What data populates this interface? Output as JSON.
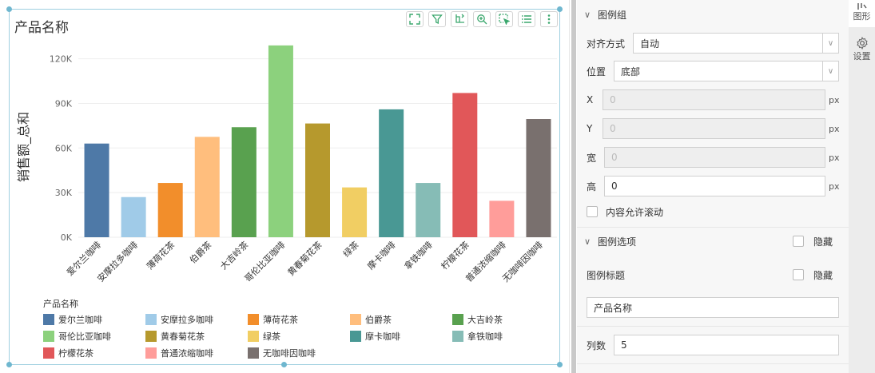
{
  "chart_title": "产品名称",
  "toolbar": {
    "icons": [
      "fullscreen-icon",
      "filter-icon",
      "sort-icon",
      "zoom-icon",
      "select-icon",
      "list-icon",
      "more-icon"
    ]
  },
  "chart_data": {
    "type": "bar",
    "title": "产品名称",
    "ylabel": "销售额_总和",
    "xlabel": "",
    "ylim": [
      0,
      130000
    ],
    "y_ticks": [
      "0K",
      "30K",
      "60K",
      "90K",
      "120K"
    ],
    "y_tick_values": [
      0,
      30000,
      60000,
      90000,
      120000
    ],
    "grid": true,
    "legend_position": "bottom",
    "categories": [
      "爱尔兰咖啡",
      "安摩拉多咖啡",
      "薄荷花茶",
      "伯爵茶",
      "大吉岭茶",
      "哥伦比亚咖啡",
      "黄春菊花茶",
      "绿茶",
      "摩卡咖啡",
      "拿铁咖啡",
      "柠檬花茶",
      "普通浓缩咖啡",
      "无咖啡因咖啡"
    ],
    "values": [
      63000,
      27000,
      36500,
      67500,
      74000,
      129000,
      76500,
      33500,
      86000,
      36500,
      97000,
      24500,
      79500
    ],
    "colors": [
      "#4e79a7",
      "#a0cbe8",
      "#f28e2b",
      "#ffbe7d",
      "#59a14f",
      "#8cd17d",
      "#b6992d",
      "#f1ce63",
      "#499894",
      "#86bcb6",
      "#e15759",
      "#ff9d9a",
      "#79706e"
    ]
  },
  "legend": {
    "title": "产品名称"
  },
  "settings": {
    "legend_group": {
      "header": "图例组",
      "align_label": "对齐方式",
      "align_value": "自动",
      "position_label": "位置",
      "position_value": "底部",
      "x_label": "X",
      "x_value": "0",
      "y_label": "Y",
      "y_value": "0",
      "width_label": "宽",
      "width_value": "0",
      "height_label": "高",
      "height_value": "0",
      "unit": "px",
      "scroll_label": "内容允许滚动"
    },
    "legend_options": {
      "header": "图例选项",
      "hide_label": "隐藏",
      "title_label": "图例标题",
      "title_hide_label": "隐藏",
      "title_value": "产品名称",
      "columns_label": "列数",
      "columns_value": "5"
    }
  },
  "tabs": {
    "graph_label": "图形",
    "settings_label": "设置"
  }
}
